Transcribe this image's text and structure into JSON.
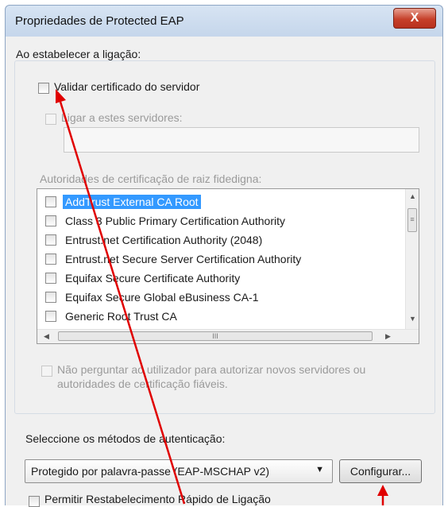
{
  "window": {
    "title": "Propriedades de Protected EAP",
    "close_label": "X"
  },
  "connection_section": {
    "heading": "Ao estabelecer a ligação:",
    "validate_certificate": {
      "label": "Validar certificado do servidor",
      "checked": false
    },
    "connect_to_servers": {
      "label": "Ligar a estes servidores:",
      "checked": false,
      "value": ""
    },
    "ca_heading": "Autoridades de certificação de raiz fidedigna:",
    "ca_list": [
      {
        "label": "AddTrust External CA Root",
        "checked": false,
        "selected": true
      },
      {
        "label": "Class 3 Public Primary Certification Authority",
        "checked": false,
        "selected": false
      },
      {
        "label": "Entrust.net Certification Authority (2048)",
        "checked": false,
        "selected": false
      },
      {
        "label": "Entrust.net Secure Server Certification Authority",
        "checked": false,
        "selected": false
      },
      {
        "label": "Equifax Secure Certificate Authority",
        "checked": false,
        "selected": false
      },
      {
        "label": "Equifax Secure Global eBusiness CA-1",
        "checked": false,
        "selected": false
      },
      {
        "label": "Generic Root Trust CA",
        "checked": false,
        "selected": false
      }
    ],
    "scroll_grip": "≡",
    "hscroll_grip": "III",
    "no_prompt": {
      "line1": "Não perguntar ao utilizador para autorizar novos servidores ou",
      "line2": "autoridades de certificação fiáveis.",
      "checked": false
    }
  },
  "auth_section": {
    "heading": "Seleccione os métodos de autenticação:",
    "method_selected": "Protegido por palavra-passe (EAP-MSCHAP v2)",
    "configure_label": "Configurar...",
    "fast_reconnect_label": "Permitir Restabelecimento Rápido de Ligação"
  },
  "colors": {
    "selection": "#3399ff",
    "annotation_arrow": "#e00000",
    "close_button": "#c6402a"
  },
  "icons": {
    "close": "close-icon",
    "dropdown": "chevron-down-icon",
    "scroll_up": "arrow-up-icon",
    "scroll_down": "arrow-down-icon",
    "scroll_left": "arrow-left-icon",
    "scroll_right": "arrow-right-icon"
  }
}
